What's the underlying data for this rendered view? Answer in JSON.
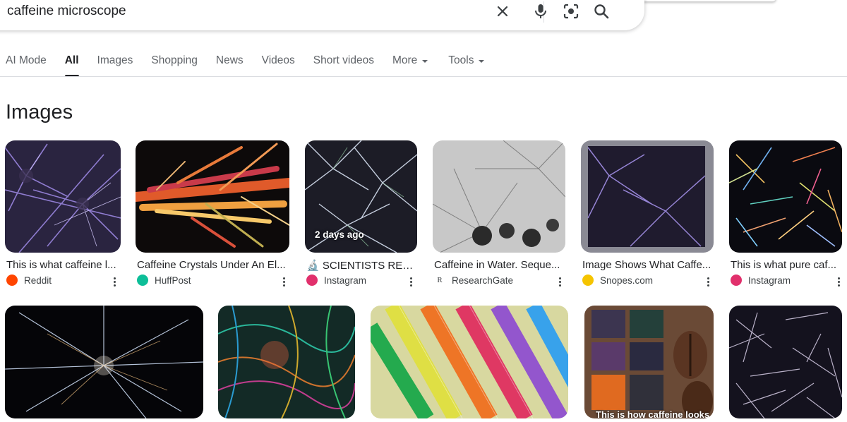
{
  "search": {
    "query": "caffeine microscope",
    "icons": [
      "close-icon",
      "microphone-icon",
      "lens-icon",
      "search-icon"
    ]
  },
  "tabs": [
    {
      "label": "AI Mode",
      "active": false
    },
    {
      "label": "All",
      "active": true
    },
    {
      "label": "Images",
      "active": false
    },
    {
      "label": "Shopping",
      "active": false
    },
    {
      "label": "News",
      "active": false
    },
    {
      "label": "Videos",
      "active": false
    },
    {
      "label": "Short videos",
      "active": false
    },
    {
      "label": "More",
      "active": false,
      "dropdown": true
    },
    {
      "label": "Tools",
      "active": false,
      "dropdown": true
    }
  ],
  "section_title": "Images",
  "images_row1": [
    {
      "title": "This is what caffeine l...",
      "source": "Reddit",
      "favicon": "reddit-icon",
      "favicon_color": "#ff4500"
    },
    {
      "title": "Caffeine Crystals Under An El...",
      "source": "HuffPost",
      "favicon": "huffpost-icon",
      "favicon_color": "#0dbe98"
    },
    {
      "title": "SCIENTISTS REV...",
      "title_prefix_icon": "microscope-emoji-icon",
      "source": "Instagram",
      "favicon": "instagram-icon",
      "favicon_color": "#e1306c",
      "badge": "2 days ago"
    },
    {
      "title": "Caffeine in Water. Seque...",
      "source": "ResearchGate",
      "favicon": "researchgate-icon",
      "favicon_color": "#40ba9b"
    },
    {
      "title": "Image Shows What Caffe...",
      "source": "Snopes.com",
      "favicon": "snopes-icon",
      "favicon_color": "#f5c400"
    },
    {
      "title": "This is what pure caf...",
      "source": "Instagram",
      "favicon": "instagram-icon",
      "favicon_color": "#e1306c"
    }
  ],
  "images_row2": [
    {
      "caption": ""
    },
    {
      "caption": ""
    },
    {
      "caption": ""
    },
    {
      "caption": "This is how caffeine looks"
    },
    {
      "caption": ""
    }
  ]
}
